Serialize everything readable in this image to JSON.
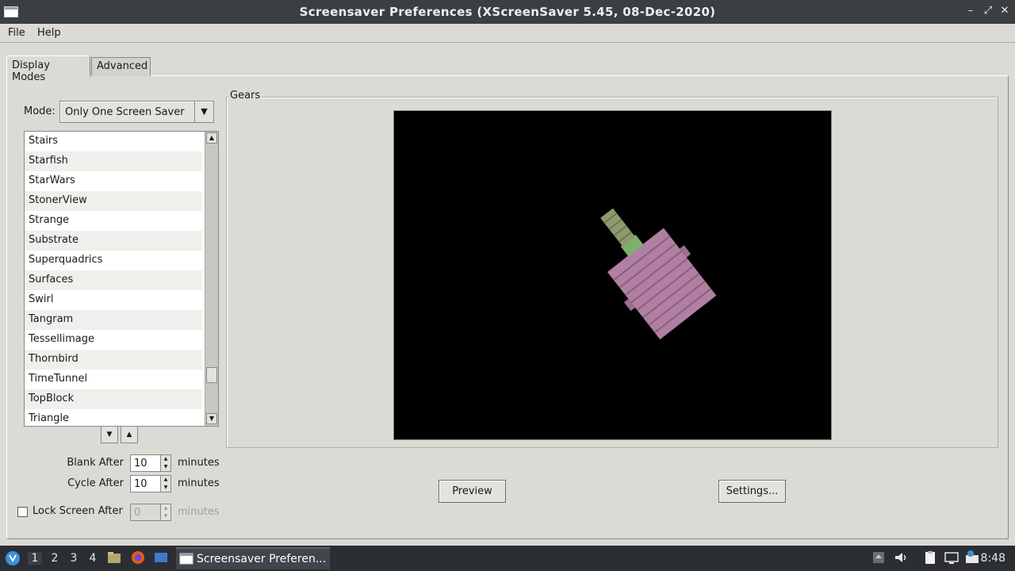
{
  "window": {
    "title": "Screensaver Preferences  (XScreenSaver 5.45, 08-Dec-2020)"
  },
  "menu": {
    "file": "File",
    "help": "Help"
  },
  "tabs": [
    {
      "label": "Display Modes",
      "active": true
    },
    {
      "label": "Advanced",
      "active": false
    }
  ],
  "mode": {
    "label": "Mode:",
    "value": "Only One Screen Saver"
  },
  "savers": [
    "Stairs",
    "Starfish",
    "StarWars",
    "StonerView",
    "Strange",
    "Substrate",
    "Superquadrics",
    "Surfaces",
    "Swirl",
    "Tangram",
    "Tessellimage",
    "Thornbird",
    "TimeTunnel",
    "TopBlock",
    "Triangle"
  ],
  "timing": {
    "blank_label": "Blank After",
    "blank_value": "10",
    "cycle_label": "Cycle After",
    "cycle_value": "10",
    "lock_label": "Lock Screen After",
    "lock_value": "0",
    "units": "minutes"
  },
  "preview": {
    "frame_title": "Gears",
    "preview_button": "Preview",
    "settings_button": "Settings..."
  },
  "taskbar": {
    "workspaces": [
      "1",
      "2",
      "3",
      "4"
    ],
    "task_label": "Screensaver Preferen...",
    "clock": "8:48"
  }
}
